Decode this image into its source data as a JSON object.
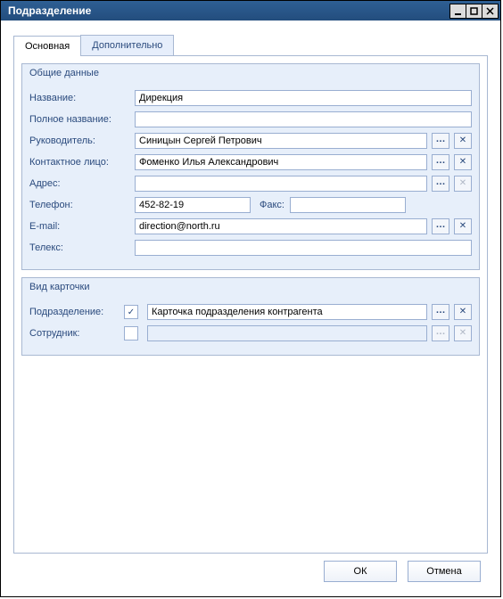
{
  "window": {
    "title": "Подразделение"
  },
  "tabs": {
    "main": "Основная",
    "extra": "Дополнительно"
  },
  "group_general": {
    "title": "Общие данные",
    "rows": {
      "name": {
        "label": "Название:",
        "value": "Дирекция"
      },
      "fullname": {
        "label": "Полное название:",
        "value": ""
      },
      "head": {
        "label": "Руководитель:",
        "value": "Синицын Сергей Петрович"
      },
      "contact": {
        "label": "Контактное лицо:",
        "value": "Фоменко Илья Александрович"
      },
      "address": {
        "label": "Адрес:",
        "value": ""
      },
      "phone": {
        "label": "Телефон:",
        "value": "452-82-19",
        "fax_label": "Факс:",
        "fax_value": ""
      },
      "email": {
        "label": "E-mail:",
        "value": "direction@north.ru"
      },
      "telex": {
        "label": "Телекс:",
        "value": ""
      }
    }
  },
  "group_card": {
    "title": "Вид карточки",
    "rows": {
      "department": {
        "label": "Подразделение:",
        "checked": true,
        "value": "Карточка подразделения контрагента"
      },
      "employee": {
        "label": "Сотрудник:",
        "checked": false,
        "value": ""
      }
    }
  },
  "buttons": {
    "ok": "ОК",
    "cancel": "Отмена"
  }
}
